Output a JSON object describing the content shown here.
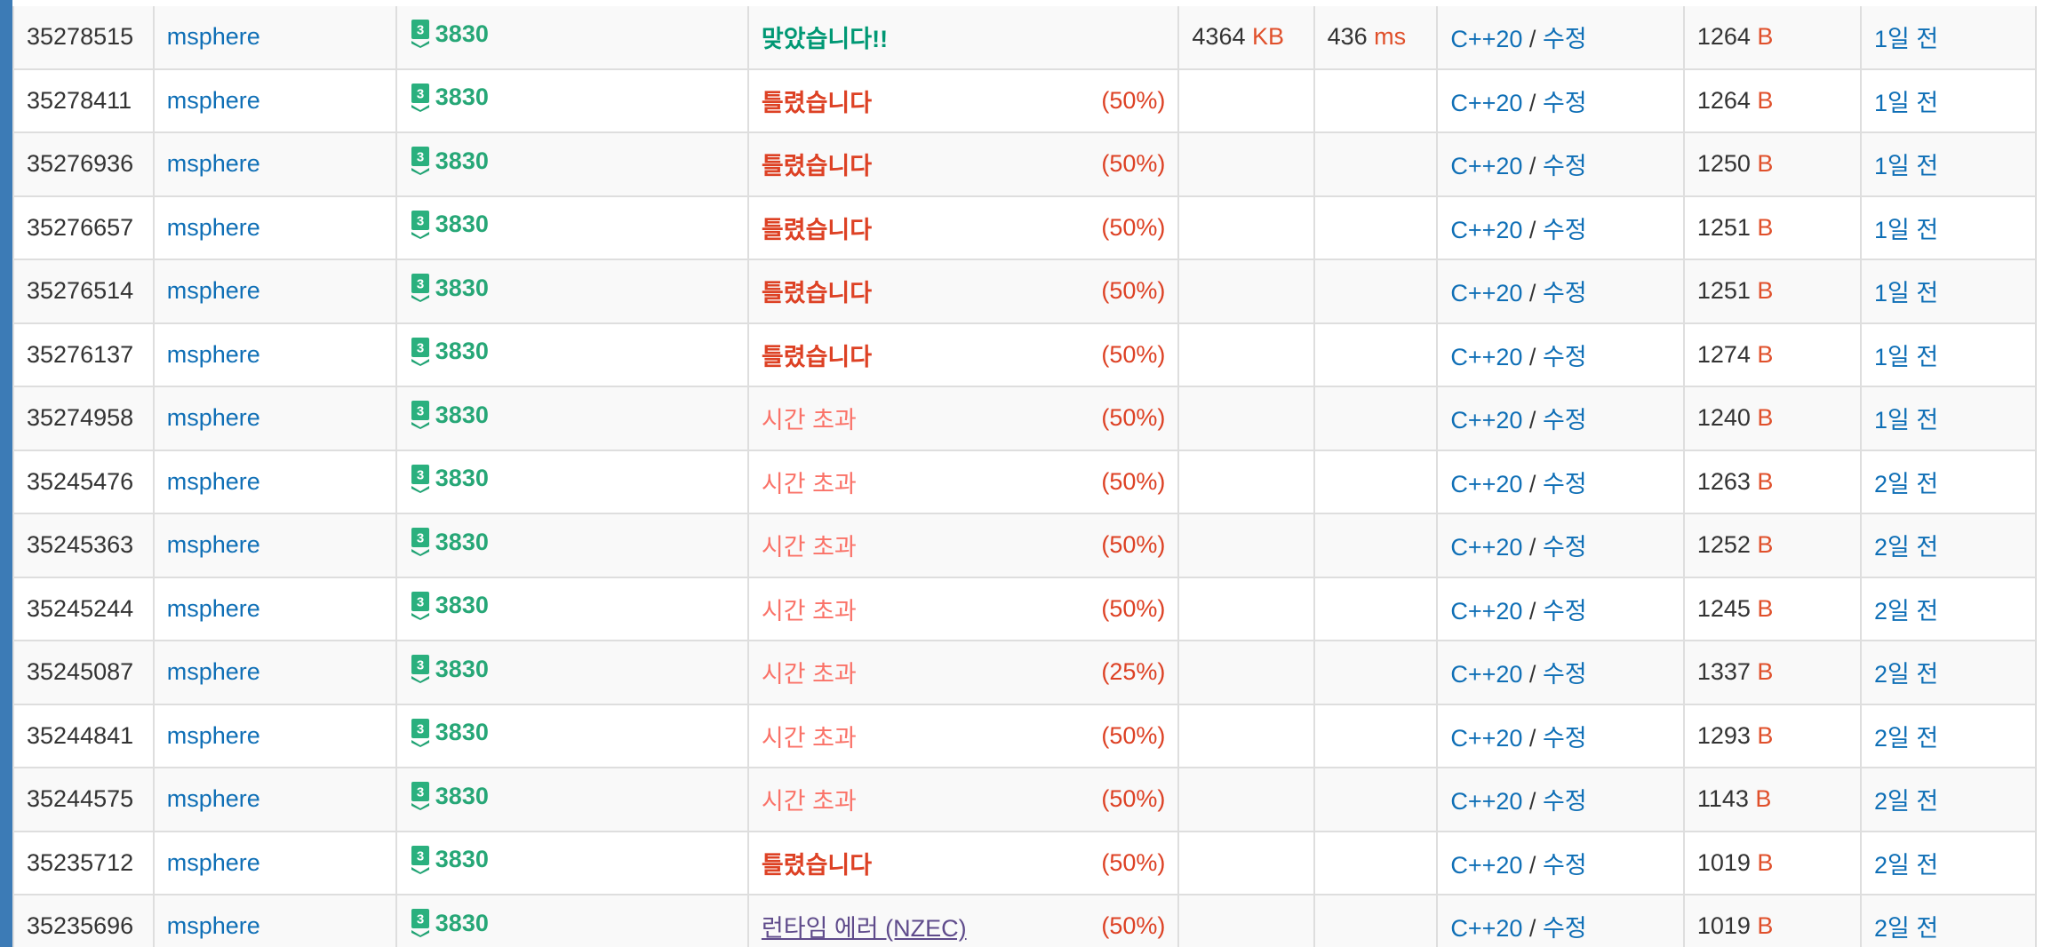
{
  "colors": {
    "accent_bar": "#3c7bb6",
    "link": "#0f6fb6",
    "problem_tier": "#27a777",
    "accepted": "#009874",
    "wrong_answer": "#dd4124",
    "time_limit": "#fa7268",
    "runtime_error": "#5f4b8b",
    "unit": "#e0502b"
  },
  "rows": [
    {
      "id": "35278515",
      "user": "msphere",
      "tier_icon": "silver-3-tier-icon",
      "tier_label": "3",
      "problem": "3830",
      "result": "맞았습니다!!",
      "result_type": "ac",
      "partial": "",
      "memory": "4364",
      "memory_unit": "KB",
      "time": "436",
      "time_unit": "ms",
      "lang": "C++20",
      "sep": "/",
      "edit": "수정",
      "length": "1264",
      "length_unit": "B",
      "ago": "1일 전"
    },
    {
      "id": "35278411",
      "user": "msphere",
      "tier_icon": "silver-3-tier-icon",
      "tier_label": "3",
      "problem": "3830",
      "result": "틀렸습니다",
      "result_type": "wa",
      "partial": "(50%)",
      "memory": "",
      "memory_unit": "",
      "time": "",
      "time_unit": "",
      "lang": "C++20",
      "sep": "/",
      "edit": "수정",
      "length": "1264",
      "length_unit": "B",
      "ago": "1일 전"
    },
    {
      "id": "35276936",
      "user": "msphere",
      "tier_icon": "silver-3-tier-icon",
      "tier_label": "3",
      "problem": "3830",
      "result": "틀렸습니다",
      "result_type": "wa",
      "partial": "(50%)",
      "memory": "",
      "memory_unit": "",
      "time": "",
      "time_unit": "",
      "lang": "C++20",
      "sep": "/",
      "edit": "수정",
      "length": "1250",
      "length_unit": "B",
      "ago": "1일 전"
    },
    {
      "id": "35276657",
      "user": "msphere",
      "tier_icon": "silver-3-tier-icon",
      "tier_label": "3",
      "problem": "3830",
      "result": "틀렸습니다",
      "result_type": "wa",
      "partial": "(50%)",
      "memory": "",
      "memory_unit": "",
      "time": "",
      "time_unit": "",
      "lang": "C++20",
      "sep": "/",
      "edit": "수정",
      "length": "1251",
      "length_unit": "B",
      "ago": "1일 전"
    },
    {
      "id": "35276514",
      "user": "msphere",
      "tier_icon": "silver-3-tier-icon",
      "tier_label": "3",
      "problem": "3830",
      "result": "틀렸습니다",
      "result_type": "wa",
      "partial": "(50%)",
      "memory": "",
      "memory_unit": "",
      "time": "",
      "time_unit": "",
      "lang": "C++20",
      "sep": "/",
      "edit": "수정",
      "length": "1251",
      "length_unit": "B",
      "ago": "1일 전"
    },
    {
      "id": "35276137",
      "user": "msphere",
      "tier_icon": "silver-3-tier-icon",
      "tier_label": "3",
      "problem": "3830",
      "result": "틀렸습니다",
      "result_type": "wa",
      "partial": "(50%)",
      "memory": "",
      "memory_unit": "",
      "time": "",
      "time_unit": "",
      "lang": "C++20",
      "sep": "/",
      "edit": "수정",
      "length": "1274",
      "length_unit": "B",
      "ago": "1일 전"
    },
    {
      "id": "35274958",
      "user": "msphere",
      "tier_icon": "silver-3-tier-icon",
      "tier_label": "3",
      "problem": "3830",
      "result": "시간 초과",
      "result_type": "tle",
      "partial": "(50%)",
      "memory": "",
      "memory_unit": "",
      "time": "",
      "time_unit": "",
      "lang": "C++20",
      "sep": "/",
      "edit": "수정",
      "length": "1240",
      "length_unit": "B",
      "ago": "1일 전"
    },
    {
      "id": "35245476",
      "user": "msphere",
      "tier_icon": "silver-3-tier-icon",
      "tier_label": "3",
      "problem": "3830",
      "result": "시간 초과",
      "result_type": "tle",
      "partial": "(50%)",
      "memory": "",
      "memory_unit": "",
      "time": "",
      "time_unit": "",
      "lang": "C++20",
      "sep": "/",
      "edit": "수정",
      "length": "1263",
      "length_unit": "B",
      "ago": "2일 전"
    },
    {
      "id": "35245363",
      "user": "msphere",
      "tier_icon": "silver-3-tier-icon",
      "tier_label": "3",
      "problem": "3830",
      "result": "시간 초과",
      "result_type": "tle",
      "partial": "(50%)",
      "memory": "",
      "memory_unit": "",
      "time": "",
      "time_unit": "",
      "lang": "C++20",
      "sep": "/",
      "edit": "수정",
      "length": "1252",
      "length_unit": "B",
      "ago": "2일 전"
    },
    {
      "id": "35245244",
      "user": "msphere",
      "tier_icon": "silver-3-tier-icon",
      "tier_label": "3",
      "problem": "3830",
      "result": "시간 초과",
      "result_type": "tle",
      "partial": "(50%)",
      "memory": "",
      "memory_unit": "",
      "time": "",
      "time_unit": "",
      "lang": "C++20",
      "sep": "/",
      "edit": "수정",
      "length": "1245",
      "length_unit": "B",
      "ago": "2일 전"
    },
    {
      "id": "35245087",
      "user": "msphere",
      "tier_icon": "silver-3-tier-icon",
      "tier_label": "3",
      "problem": "3830",
      "result": "시간 초과",
      "result_type": "tle",
      "partial": "(25%)",
      "memory": "",
      "memory_unit": "",
      "time": "",
      "time_unit": "",
      "lang": "C++20",
      "sep": "/",
      "edit": "수정",
      "length": "1337",
      "length_unit": "B",
      "ago": "2일 전"
    },
    {
      "id": "35244841",
      "user": "msphere",
      "tier_icon": "silver-3-tier-icon",
      "tier_label": "3",
      "problem": "3830",
      "result": "시간 초과",
      "result_type": "tle",
      "partial": "(50%)",
      "memory": "",
      "memory_unit": "",
      "time": "",
      "time_unit": "",
      "lang": "C++20",
      "sep": "/",
      "edit": "수정",
      "length": "1293",
      "length_unit": "B",
      "ago": "2일 전"
    },
    {
      "id": "35244575",
      "user": "msphere",
      "tier_icon": "silver-3-tier-icon",
      "tier_label": "3",
      "problem": "3830",
      "result": "시간 초과",
      "result_type": "tle",
      "partial": "(50%)",
      "memory": "",
      "memory_unit": "",
      "time": "",
      "time_unit": "",
      "lang": "C++20",
      "sep": "/",
      "edit": "수정",
      "length": "1143",
      "length_unit": "B",
      "ago": "2일 전"
    },
    {
      "id": "35235712",
      "user": "msphere",
      "tier_icon": "silver-3-tier-icon",
      "tier_label": "3",
      "problem": "3830",
      "result": "틀렸습니다",
      "result_type": "wa",
      "partial": "(50%)",
      "memory": "",
      "memory_unit": "",
      "time": "",
      "time_unit": "",
      "lang": "C++20",
      "sep": "/",
      "edit": "수정",
      "length": "1019",
      "length_unit": "B",
      "ago": "2일 전"
    },
    {
      "id": "35235696",
      "user": "msphere",
      "tier_icon": "silver-3-tier-icon",
      "tier_label": "3",
      "problem": "3830",
      "result": "런타임 에러 (NZEC)",
      "result_type": "rte",
      "partial": "(50%)",
      "memory": "",
      "memory_unit": "",
      "time": "",
      "time_unit": "",
      "lang": "C++20",
      "sep": "/",
      "edit": "수정",
      "length": "1019",
      "length_unit": "B",
      "ago": "2일 전"
    }
  ]
}
